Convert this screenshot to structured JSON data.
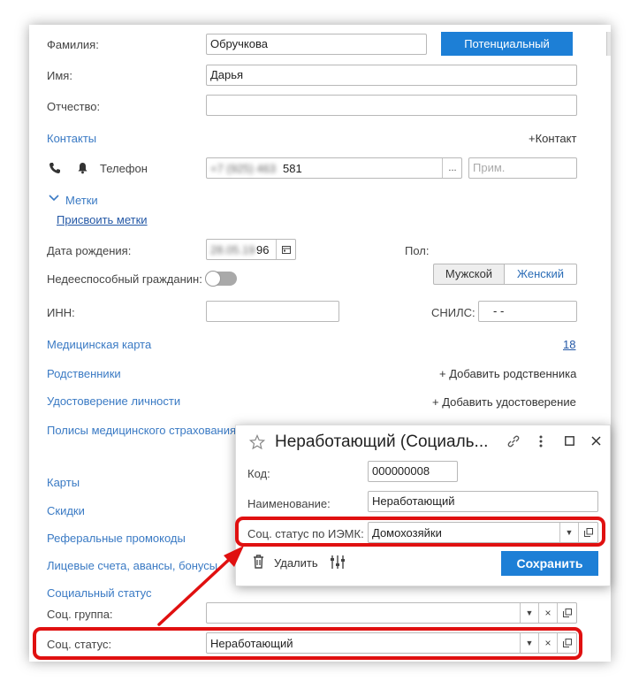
{
  "form": {
    "surname": {
      "label": "Фамилия:",
      "value": "Обручкова"
    },
    "status_button": "Потенциальный",
    "name": {
      "label": "Имя:",
      "value": "Дарья"
    },
    "patronymic": {
      "label": "Отчество:",
      "value": ""
    },
    "contacts_link": "Контакты",
    "add_contact": "+Контакт",
    "phone": {
      "label": "Телефон",
      "value_hidden": "+7 (925) 463",
      "value_visible": "581",
      "more": "...",
      "note_placeholder": "Прим."
    },
    "tags": {
      "label": "Метки",
      "assign": "Присвоить метки"
    },
    "birth_date": {
      "label": "Дата рождения:",
      "value_hidden": "28.05.19",
      "value_visible": "96"
    },
    "gender": {
      "label": "Пол:",
      "male": "Мужской",
      "female": "Женский"
    },
    "incapable": {
      "label": "Недееспособный гражданин:"
    },
    "inn": {
      "label": "ИНН:",
      "value": ""
    },
    "snils": {
      "label": "СНИЛС:",
      "value": "-   -"
    },
    "medical_card": {
      "label": "Медицинская карта",
      "value": "18"
    },
    "relatives": {
      "label": "Родственники",
      "add": "+ Добавить родственника"
    },
    "id_doc": {
      "label": "Удостоверение личности",
      "add": "+ Добавить удостоверение"
    },
    "insurance": {
      "label": "Полисы медицинского страхования"
    },
    "cards": "Карты",
    "discounts": "Скидки",
    "promo": "Реферальные промокоды",
    "accounts": "Лицевые счета, авансы, бонусы",
    "social_status_link": "Социальный статус",
    "soc_group": {
      "label": "Соц. группа:",
      "value": ""
    },
    "soc_status": {
      "label": "Соц. статус:",
      "value": "Неработающий"
    }
  },
  "dialog": {
    "title": "Неработающий (Социаль...",
    "code": {
      "label": "Код:",
      "value": "000000008"
    },
    "name": {
      "label": "Наименование:",
      "value": "Неработающий"
    },
    "iemk": {
      "label": "Соц. статус по ИЭМК:",
      "value": "Домохозяйки"
    },
    "delete": "Удалить",
    "save": "Сохранить"
  },
  "colors": {
    "accent": "#1d7fd6",
    "link": "#3a7ac4",
    "highlight": "#e01010"
  }
}
